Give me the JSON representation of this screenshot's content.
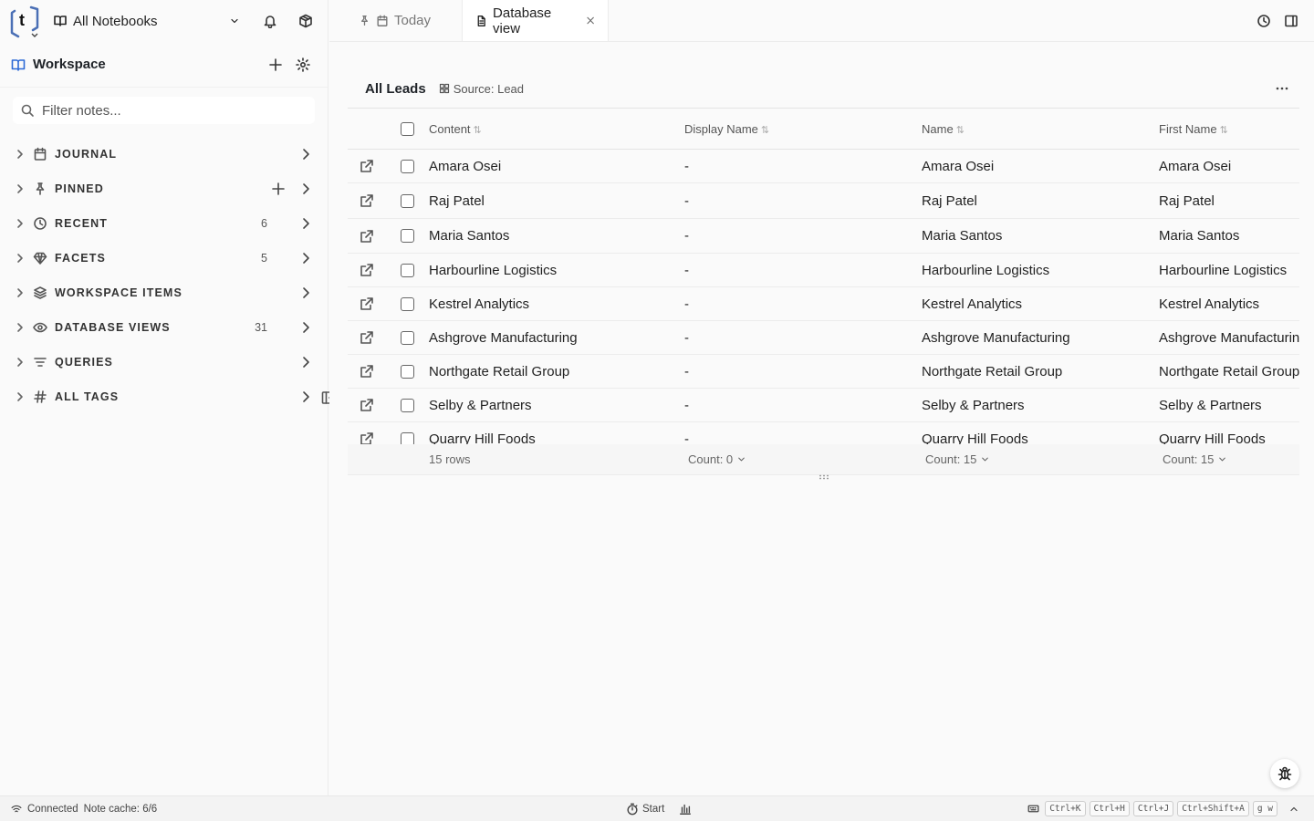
{
  "topbar": {
    "logo_letter": "t",
    "notebook_label": "All Notebooks"
  },
  "workspace": {
    "title": "Workspace",
    "filter_placeholder": "Filter notes..."
  },
  "sections": [
    {
      "label": "JOURNAL",
      "count": "",
      "icon": "calendar-icon"
    },
    {
      "label": "PINNED",
      "count": "",
      "icon": "pin-icon"
    },
    {
      "label": "RECENT",
      "count": "6",
      "icon": "clock-icon"
    },
    {
      "label": "FACETS",
      "count": "5",
      "icon": "gem-icon"
    },
    {
      "label": "WORKSPACE ITEMS",
      "count": "",
      "icon": "layers-icon"
    },
    {
      "label": "DATABASE VIEWS",
      "count": "31",
      "icon": "eye-icon"
    },
    {
      "label": "QUERIES",
      "count": "",
      "icon": "filter-icon"
    },
    {
      "label": "ALL TAGS",
      "count": "",
      "icon": "hash-icon"
    }
  ],
  "tabs": [
    {
      "label": "Today"
    },
    {
      "label": "Database view"
    }
  ],
  "view": {
    "title": "All Leads",
    "source": "Source: Lead"
  },
  "table": {
    "columns": [
      "Content",
      "Display Name",
      "Name",
      "First Name"
    ],
    "rows": [
      {
        "content": "Amara Osei",
        "display": "-",
        "name": "Amara Osei",
        "first": "Amara Osei"
      },
      {
        "content": "Raj Patel",
        "display": "-",
        "name": "Raj Patel",
        "first": "Raj Patel"
      },
      {
        "content": "Maria Santos",
        "display": "-",
        "name": "Maria Santos",
        "first": "Maria Santos"
      },
      {
        "content": "Harbourline Logistics",
        "display": "-",
        "name": "Harbourline Logistics",
        "first": "Harbourline Logistics"
      },
      {
        "content": "Kestrel Analytics",
        "display": "-",
        "name": "Kestrel Analytics",
        "first": "Kestrel Analytics"
      },
      {
        "content": "Ashgrove Manufacturing",
        "display": "-",
        "name": "Ashgrove Manufacturing",
        "first": "Ashgrove Manufacturing"
      },
      {
        "content": "Northgate Retail Group",
        "display": "-",
        "name": "Northgate Retail Group",
        "first": "Northgate Retail Group"
      },
      {
        "content": "Selby & Partners",
        "display": "-",
        "name": "Selby & Partners",
        "first": "Selby & Partners"
      },
      {
        "content": "Quarry Hill Foods",
        "display": "-",
        "name": "Quarry Hill Foods",
        "first": "Quarry Hill Foods"
      }
    ],
    "footer": {
      "rows_label": "15 rows",
      "display_count": "Count: 0",
      "name_count": "Count: 15",
      "first_count": "Count: 15"
    }
  },
  "status": {
    "connected": "Connected",
    "cache": "Note cache: 6/6",
    "start": "Start",
    "shortcuts": [
      "Ctrl+K",
      "Ctrl+H",
      "Ctrl+J",
      "Ctrl+Shift+A",
      "g w"
    ]
  },
  "colors": {
    "accent": "#4a6fb5",
    "logo": "#4a6fb5"
  }
}
